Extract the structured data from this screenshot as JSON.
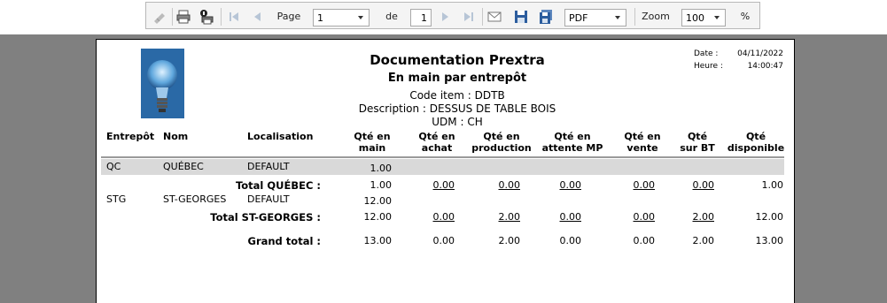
{
  "toolbar": {
    "page_label": "Page",
    "page_value": "1",
    "of_label": "de",
    "total_pages": "1",
    "export_format": "PDF",
    "zoom_label": "Zoom",
    "zoom_value": "100",
    "percent_label": "%"
  },
  "report": {
    "title": "Documentation Prextra",
    "subtitle": "En main par entrepôt",
    "code_item": "Code item : DDTB",
    "description": "Description : DESSUS DE TABLE BOIS",
    "udm": "UDM : CH",
    "date_label": "Date :",
    "date_value": "04/11/2022",
    "time_label": "Heure :",
    "time_value": "14:00:47"
  },
  "columns": {
    "entrepot": "Entrepôt",
    "nom": "Nom",
    "localisation": "Localisation",
    "qte_main_1": "Qté en",
    "qte_main_2": "main",
    "qte_achat_1": "Qté en",
    "qte_achat_2": "achat",
    "qte_prod_1": "Qté en",
    "qte_prod_2": "production",
    "qte_mp_1": "Qté en",
    "qte_mp_2": "attente MP",
    "qte_vente_1": "Qté en",
    "qte_vente_2": "vente",
    "qte_bt_1": "Qté",
    "qte_bt_2": "sur BT",
    "qte_dispo_1": "Qté",
    "qte_dispo_2": "disponible"
  },
  "rows": [
    {
      "entrepot": "QC",
      "nom": "QUÉBEC",
      "localisation": "DEFAULT",
      "main": "1.00"
    },
    {
      "entrepot": "STG",
      "nom": "ST-GEORGES",
      "localisation": "DEFAULT",
      "main": "12.00"
    }
  ],
  "totals": [
    {
      "label": "Total QUÉBEC :",
      "main": "1.00",
      "achat": "0.00",
      "production": "0.00",
      "attente_mp": "0.00",
      "vente": "0.00",
      "sur_bt": "0.00",
      "disponible": "1.00"
    },
    {
      "label": "Total ST-GEORGES :",
      "main": "12.00",
      "achat": "0.00",
      "production": "2.00",
      "attente_mp": "0.00",
      "vente": "0.00",
      "sur_bt": "2.00",
      "disponible": "12.00"
    }
  ],
  "grand_total": {
    "label": "Grand total :",
    "main": "13.00",
    "achat": "0.00",
    "production": "2.00",
    "attente_mp": "0.00",
    "vente": "0.00",
    "sur_bt": "2.00",
    "disponible": "13.00"
  },
  "colors": {
    "viewer_bg": "#808080",
    "row_shade": "#d9d9d9",
    "logo_blue": "#2f6fa8"
  }
}
